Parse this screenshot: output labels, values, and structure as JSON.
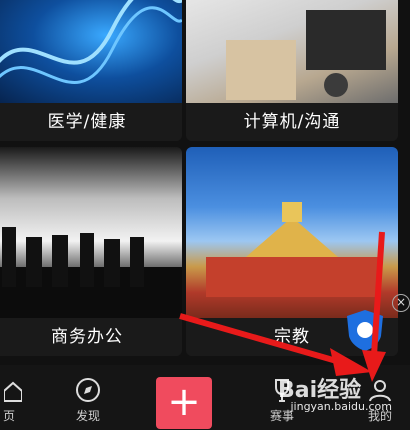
{
  "categories": [
    {
      "label": "医学/健康"
    },
    {
      "label": "计算机/沟通"
    },
    {
      "label": "商务办公"
    },
    {
      "label": "宗教"
    }
  ],
  "tabbar": {
    "home_label": "页",
    "discover_label": "发现",
    "contest_label": "赛事",
    "mine_label": "我的",
    "plus_glyph": "+"
  },
  "watermark": {
    "logo": "Bai经验",
    "url": "jingyan.baidu.com"
  },
  "close_glyph": "×",
  "colors": {
    "accent": "#f04b5e",
    "arrow": "#e81a1a"
  }
}
